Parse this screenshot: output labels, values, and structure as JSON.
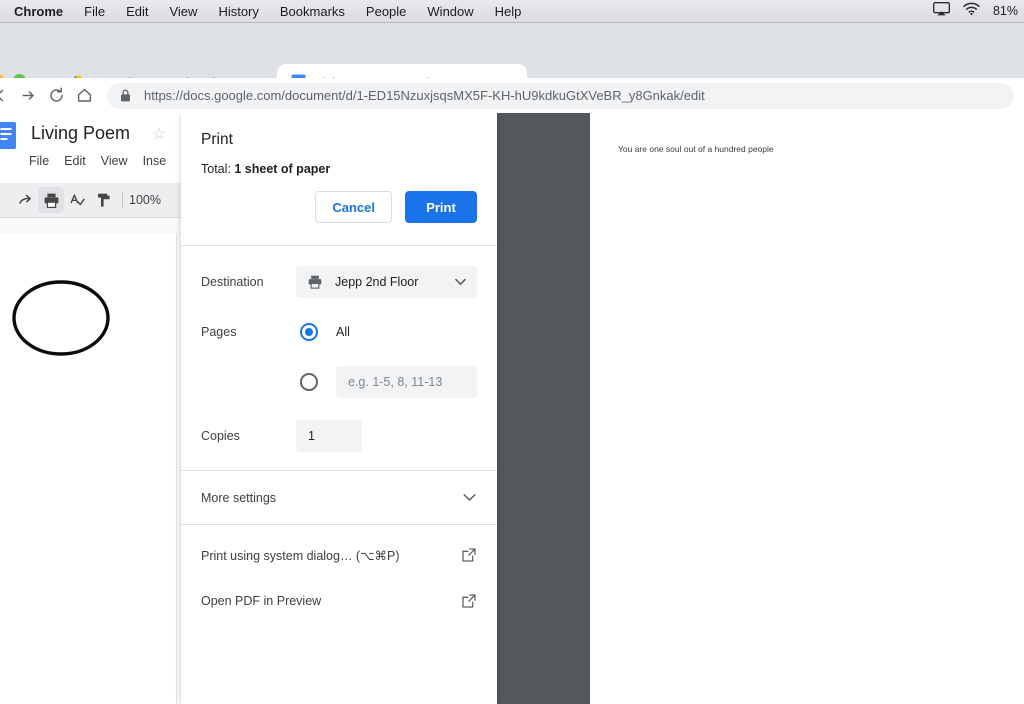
{
  "menubar": {
    "app": "Chrome",
    "items": [
      "File",
      "Edit",
      "View",
      "History",
      "Bookmarks",
      "People",
      "Window",
      "Help"
    ],
    "airplay_icon": "airplay-icon",
    "wifi_icon": "wifi-icon",
    "battery": "81%"
  },
  "browser": {
    "tabs": [
      {
        "title": "My Drive - Google Drive",
        "favicon": "google-drive-icon",
        "active": false
      },
      {
        "title": "Living Poem - Google Docs",
        "favicon": "google-docs-icon",
        "active": true
      }
    ],
    "new_tab_label": "+",
    "close_label": "×",
    "nav": {
      "back_icon": "back-arrow-icon",
      "forward_icon": "forward-arrow-icon",
      "reload_icon": "reload-icon",
      "home_icon": "home-icon"
    },
    "omnibox": {
      "lock_icon": "lock-icon",
      "scheme": "https://",
      "domain": "docs.google.com",
      "path": "/document/d/1-ED15NzuxjsqsMX5F-KH-hU9kdkuGtXVeBR_y8Gnkak/edit",
      "full_url": "https://docs.google.com/document/d/1-ED15NzuxjsqsMX5F-KH-hU9kdkuGtXVeBR_y8Gnkak/edit"
    }
  },
  "docs": {
    "title": "Living Poem",
    "star_icon": "star-outline-icon",
    "menu": [
      "File",
      "Edit",
      "View",
      "Inse"
    ],
    "toolbar": {
      "redo_icon": "redo-icon",
      "print_icon": "print-icon",
      "spellcheck_icon": "spellcheck-icon",
      "paint_format_icon": "paint-format-icon",
      "zoom": "100%"
    },
    "annotation": "hand-drawn-ellipse"
  },
  "preview": {
    "document_text": "You are one soul out of a hundred people"
  },
  "print_dialog": {
    "title": "Print",
    "total_prefix": "Total: ",
    "total_value": "1 sheet of paper",
    "cancel_label": "Cancel",
    "print_label": "Print",
    "destination": {
      "label": "Destination",
      "icon": "printer-icon",
      "value": "Jepp 2nd Floor",
      "caret_icon": "chevron-down-icon"
    },
    "pages": {
      "label": "Pages",
      "all_option": "All",
      "all_selected": true,
      "custom_selected": false,
      "custom_placeholder": "e.g. 1-5, 8, 11-13",
      "custom_value": ""
    },
    "copies": {
      "label": "Copies",
      "value": "1"
    },
    "more_settings": {
      "label": "More settings",
      "chevron_icon": "chevron-down-icon",
      "expanded": false
    },
    "links": [
      {
        "label": "Print using system dialog… (⌥⌘P)",
        "icon": "external-link-icon"
      },
      {
        "label": "Open PDF in Preview",
        "icon": "external-link-icon"
      }
    ]
  },
  "colors": {
    "accent_blue": "#1a73e8",
    "preview_backdrop": "#53585c",
    "chrome_tabstrip": "#dee1e6",
    "docs_toolbar": "#edeef0"
  }
}
